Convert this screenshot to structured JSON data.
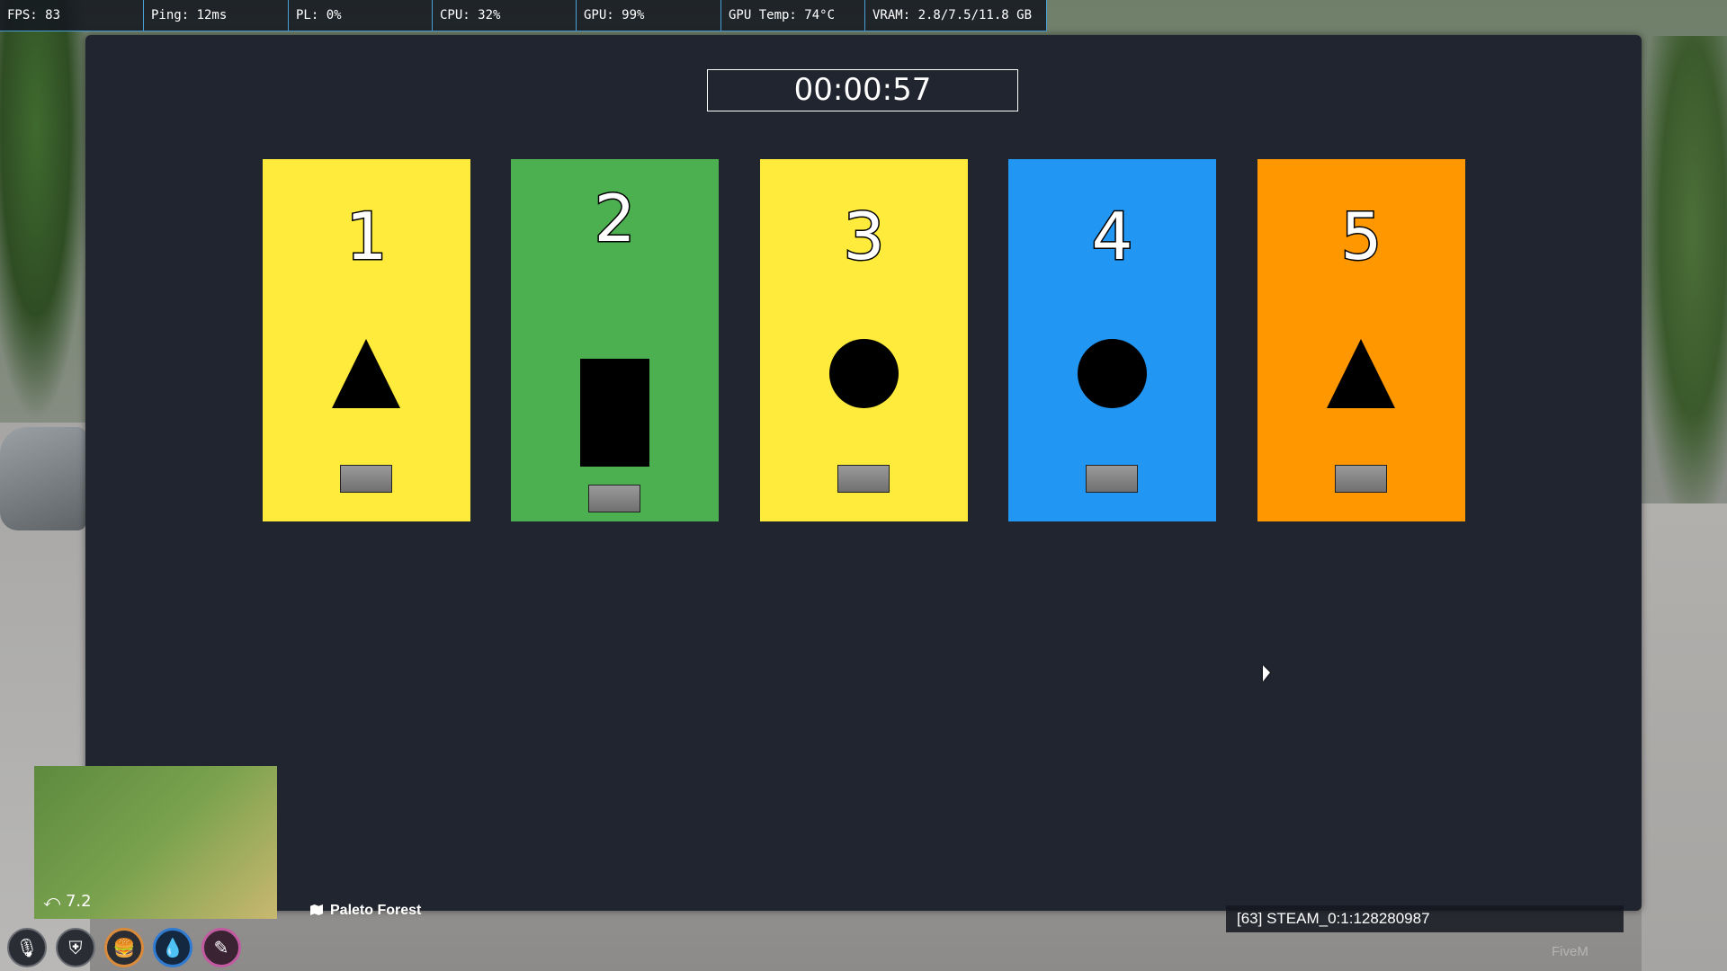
{
  "perf": {
    "fps": "FPS: 83",
    "ping": "Ping: 12ms",
    "pl": "PL: 0%",
    "cpu": "CPU: 32%",
    "gpu": "GPU: 99%",
    "gpu_temp": "GPU Temp: 74°C",
    "vram": "VRAM: 2.8/7.5/11.8 GB"
  },
  "game": {
    "timer": "00:00:57",
    "cards": [
      {
        "number": "1",
        "color": "#ffeb3b",
        "shape": "triangle-icon"
      },
      {
        "number": "2",
        "color": "#4caf50",
        "shape": "rectangle-icon"
      },
      {
        "number": "3",
        "color": "#ffeb3b",
        "shape": "circle-icon"
      },
      {
        "number": "4",
        "color": "#2196f3",
        "shape": "circle-icon"
      },
      {
        "number": "5",
        "color": "#ff9800",
        "shape": "triangle-icon"
      }
    ]
  },
  "hud": {
    "location": "Paleto Forest",
    "minimap_text": "7.2",
    "steam_id": "[63] STEAM_0:1:128280987",
    "watermark": "FiveM",
    "status_icons": [
      "microphone-icon",
      "shield-icon",
      "burger-icon",
      "water-drop-icon",
      "stress-icon"
    ]
  }
}
